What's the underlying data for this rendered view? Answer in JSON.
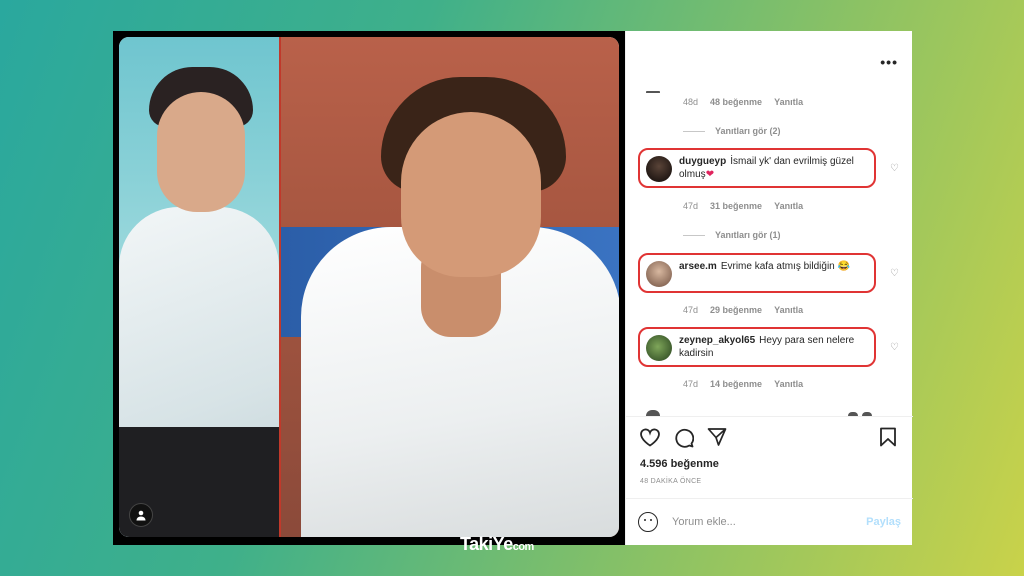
{
  "colors": {
    "highlight": "#e03434",
    "link_disabled": "#b2dffc",
    "meta": "#8e8e8e"
  },
  "post": {
    "comments": [
      {
        "meta": {
          "age": "48d",
          "likes": "48 beğenme",
          "reply": "Yanıtla"
        },
        "replies": "Yanıtları gör (2)"
      },
      {
        "user": "duygueyp",
        "text": "İsmail yk' dan evrilmiş güzel olmuş",
        "emoji": "❤",
        "meta": {
          "age": "47d",
          "likes": "31 beğenme",
          "reply": "Yanıtla"
        },
        "replies": "Yanıtları gör (1)"
      },
      {
        "user": "arsee.m",
        "text": "Evrime kafa atmış bildiğin",
        "emoji": "😂",
        "meta": {
          "age": "47d",
          "likes": "29 beğenme",
          "reply": "Yanıtla"
        }
      },
      {
        "user": "zeynep_akyol65",
        "text": "Heyy para sen nelere kadirsin",
        "meta": {
          "age": "47d",
          "likes": "14 beğenme",
          "reply": "Yanıtla"
        }
      }
    ],
    "likes_label": "4.596 beğenme",
    "time_ago": "48 DAKİKA ÖNCE",
    "comment_placeholder": "Yorum ekle...",
    "post_button": "Paylaş",
    "icons": [
      "more-icon",
      "heart-icon",
      "comment-icon",
      "share-icon",
      "save-icon",
      "emoji-icon",
      "user-tag-icon"
    ]
  },
  "watermark": {
    "main": "TakiYe",
    "suffix": "com"
  }
}
